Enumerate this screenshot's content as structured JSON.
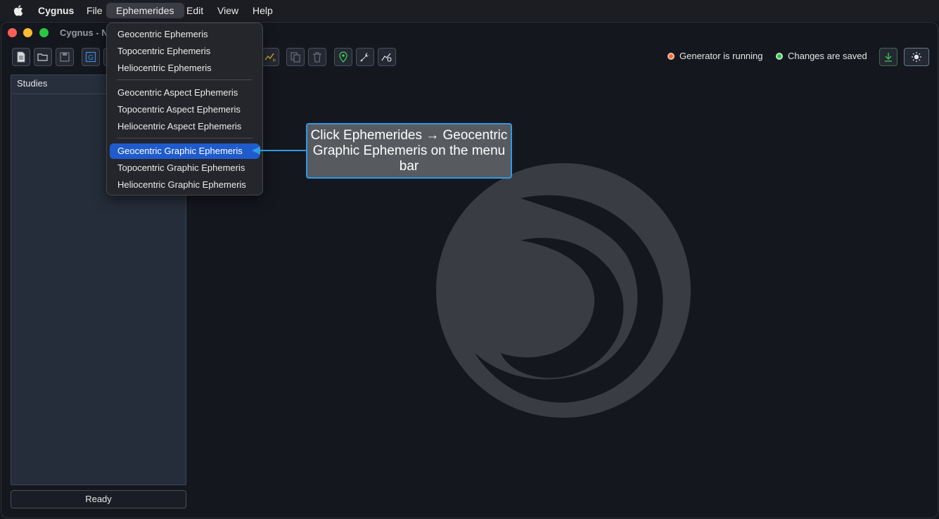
{
  "menubar": {
    "app_name": "Cygnus",
    "items": [
      "File",
      "Ephemerides",
      "Edit",
      "View",
      "Help"
    ]
  },
  "window": {
    "title": "Cygnus - N"
  },
  "toolbar": {
    "icons": [
      "new-document-icon",
      "open-folder-icon",
      "save-icon",
      "g-icon",
      "chart-h-icon",
      "copy-icon",
      "trash-icon",
      "location-pin-icon",
      "wrench-icon",
      "chart-gear-icon"
    ]
  },
  "status": {
    "generator": "Generator is running",
    "changes": "Changes are saved"
  },
  "sidebar": {
    "header": "Studies",
    "footer": "Ready"
  },
  "dropdown": {
    "items": [
      "Geocentric Ephemeris",
      "Topocentric Ephemeris",
      "Heliocentric Ephemeris",
      "Geocentric Aspect Ephemeris",
      "Topocentric Aspect Ephemeris",
      "Heliocentric Aspect Ephemeris",
      "Geocentric Graphic Ephemeris",
      "Topocentric Graphic Ephemeris",
      "Heliocentric Graphic Ephemeris"
    ],
    "selected": "Geocentric Graphic Ephemeris"
  },
  "callout": {
    "text": "Click Ephemerides → Geocentric Graphic Ephemeris on the menu bar"
  },
  "colors": {
    "accent": "#1f5bcc",
    "callout_border": "#2e9be6",
    "status_running": "#ee6a3c",
    "status_saved": "#2fbf4a"
  }
}
